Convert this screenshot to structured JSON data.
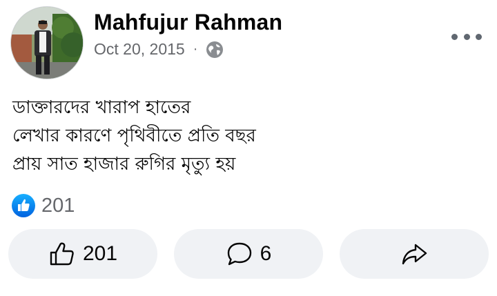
{
  "post": {
    "author": "Mahfujur Rahman",
    "date": "Oct 20, 2015",
    "separator": "·",
    "privacy_icon": "globe-icon",
    "text_lines": [
      "ডাক্তারদের খারাপ হাতের",
      "লেখার কারণে পৃথিবীতে প্রতি বছর",
      "প্রায় সাত হাজার রুগির মৃত্যু হয়"
    ]
  },
  "reactions": {
    "icon": "like-reaction-icon",
    "count": "201"
  },
  "actions": {
    "like": {
      "icon": "thumbs-up-icon",
      "count": "201"
    },
    "comment": {
      "icon": "comment-icon",
      "count": "6"
    },
    "share": {
      "icon": "share-icon"
    }
  },
  "colors": {
    "accent": "#1877f2",
    "secondary_text": "#65676b",
    "button_bg": "#f0f2f5"
  }
}
